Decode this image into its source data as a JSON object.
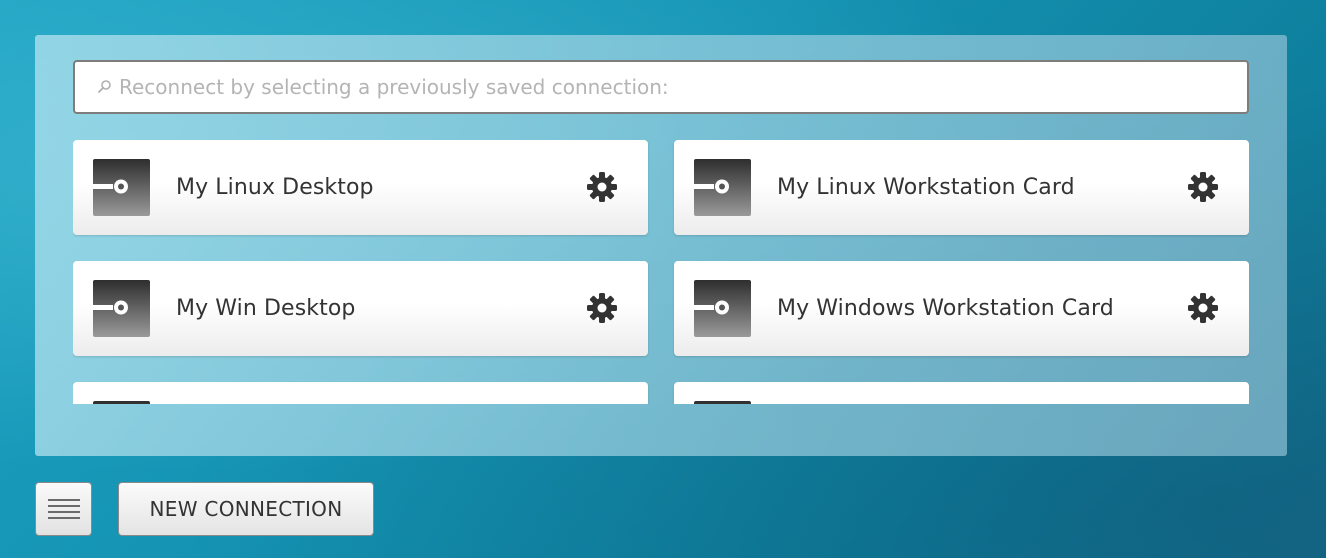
{
  "search": {
    "placeholder": "Reconnect by selecting a previously saved connection:",
    "value": ""
  },
  "connections": [
    {
      "name": "My Linux Desktop",
      "icon": "connection-icon",
      "settings_icon": "gear-icon"
    },
    {
      "name": "My Linux Workstation Card",
      "icon": "connection-icon",
      "settings_icon": "gear-icon"
    },
    {
      "name": "My Win Desktop",
      "icon": "connection-icon",
      "settings_icon": "gear-icon"
    },
    {
      "name": "My Windows Workstation Card",
      "icon": "connection-icon",
      "settings_icon": "gear-icon"
    },
    {
      "name": "",
      "icon": "connection-icon",
      "settings_icon": "gear-icon"
    },
    {
      "name": "",
      "icon": "connection-icon",
      "settings_icon": "gear-icon"
    }
  ],
  "toolbar": {
    "menu_icon": "hamburger-menu-icon",
    "new_connection_label": "NEW CONNECTION"
  },
  "colors": {
    "background": "#1593b3",
    "panel": "#a6d6e4",
    "card": "#ffffff",
    "icon_dark": "#3a3a3a",
    "gear": "#333333"
  }
}
